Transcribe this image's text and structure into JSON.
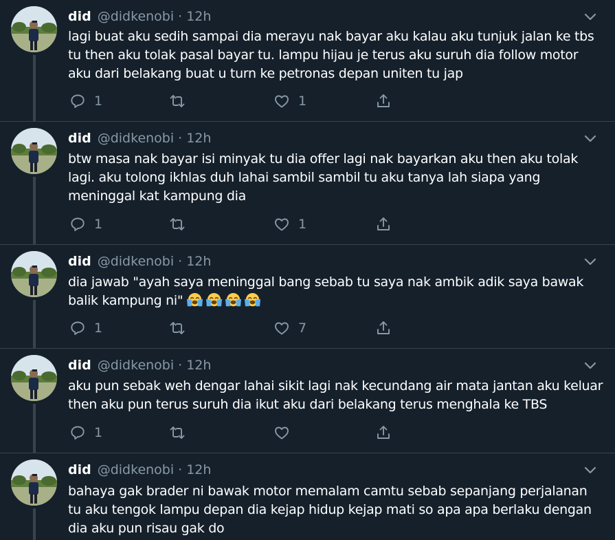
{
  "tweets": [
    {
      "name": "did",
      "handle": "@didkenobi",
      "dot": "·",
      "time": "12h",
      "text": "lagi buat aku sedih sampai dia merayu nak bayar aku kalau aku tunjuk jalan ke tbs tu then aku tolak pasal bayar tu. lampu hijau je terus aku suruh dia follow motor aku dari belakang buat u turn ke petronas depan uniten tu jap",
      "emojis": [],
      "reply_count": "1",
      "retweet_count": "",
      "like_count": "1"
    },
    {
      "name": "did",
      "handle": "@didkenobi",
      "dot": "·",
      "time": "12h",
      "text": "btw masa nak bayar isi minyak tu dia offer lagi nak bayarkan aku then aku tolak lagi. aku tolong ikhlas duh lahai sambil sambil tu aku tanya lah siapa yang meninggal kat kampung dia",
      "emojis": [],
      "reply_count": "1",
      "retweet_count": "",
      "like_count": "1"
    },
    {
      "name": "did",
      "handle": "@didkenobi",
      "dot": "·",
      "time": "12h",
      "text": "dia jawab \"ayah saya meninggal bang sebab tu saya nak ambik adik saya bawak balik kampung ni\"",
      "emojis": [
        "loudly-crying-face",
        "loudly-crying-face",
        "loudly-crying-face",
        "loudly-crying-face"
      ],
      "reply_count": "1",
      "retweet_count": "",
      "like_count": "7"
    },
    {
      "name": "did",
      "handle": "@didkenobi",
      "dot": "·",
      "time": "12h",
      "text": "aku pun sebak weh dengar lahai sikit lagi nak kecundang air mata jantan aku keluar then aku pun terus suruh dia ikut aku dari belakang terus menghala ke TBS",
      "emojis": [],
      "reply_count": "1",
      "retweet_count": "",
      "like_count": ""
    },
    {
      "name": "did",
      "handle": "@didkenobi",
      "dot": "·",
      "time": "12h",
      "text": "bahaya gak brader ni bawak motor memalam camtu sebab sepanjang perjalanan tu aku tengok lampu depan dia kejap hidup kejap mati so apa apa berlaku dengan dia aku pun risau gak do",
      "emojis": [],
      "reply_count": "",
      "retweet_count": "",
      "like_count": ""
    }
  ],
  "icons": {
    "reply": "reply-icon",
    "retweet": "retweet-icon",
    "like": "like-icon",
    "share": "share-icon",
    "more": "chevron-down-icon"
  },
  "colors": {
    "background": "#15202b",
    "divider": "#38444d",
    "text": "#ffffff",
    "secondary": "#8899a6"
  }
}
